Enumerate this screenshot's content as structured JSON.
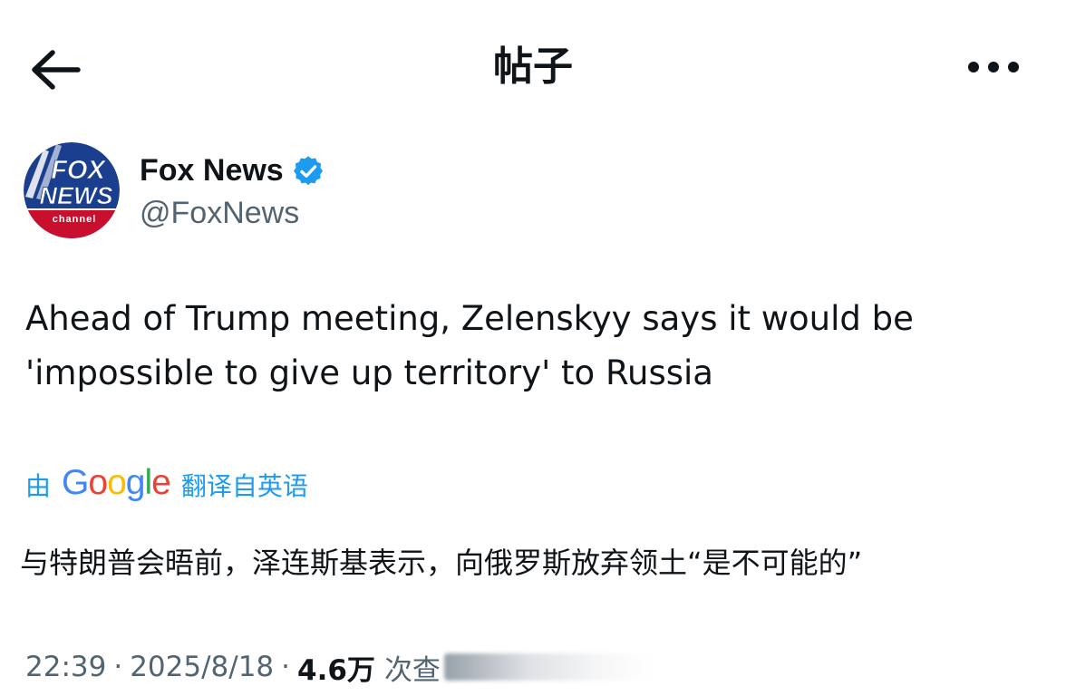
{
  "header": {
    "title": "帖子",
    "back_icon": "arrow-left-icon",
    "more_icon": "more-horizontal-icon"
  },
  "author": {
    "display_name": "Fox News",
    "handle": "@FoxNews",
    "verified_color": "#1d9bf0",
    "avatar": {
      "line1": "FOX",
      "line2": "NEWS",
      "line3": "channel",
      "colors": {
        "blue": "#1b3f8f",
        "red": "#c8102e",
        "white": "#ffffff"
      }
    }
  },
  "tweet": {
    "text_line1": "Ahead of Trump meeting, Zelenskyy says it would be",
    "text_line2": "'impossible to give up territory' to Russia"
  },
  "translation": {
    "prefix": "由",
    "provider": {
      "g1": "G",
      "o1": "o",
      "o2": "o",
      "g2": "g",
      "l": "l",
      "e": "e"
    },
    "suffix": "翻译自英语",
    "text": "与特朗普会晤前，泽连斯基表示，向俄罗斯放弃领土“是不可能的”",
    "link_color": "#1d9bf0"
  },
  "meta": {
    "time": "22:39",
    "separator": "·",
    "date": "2025/8/18",
    "views_count": "4.6万",
    "views_label": "次查"
  }
}
